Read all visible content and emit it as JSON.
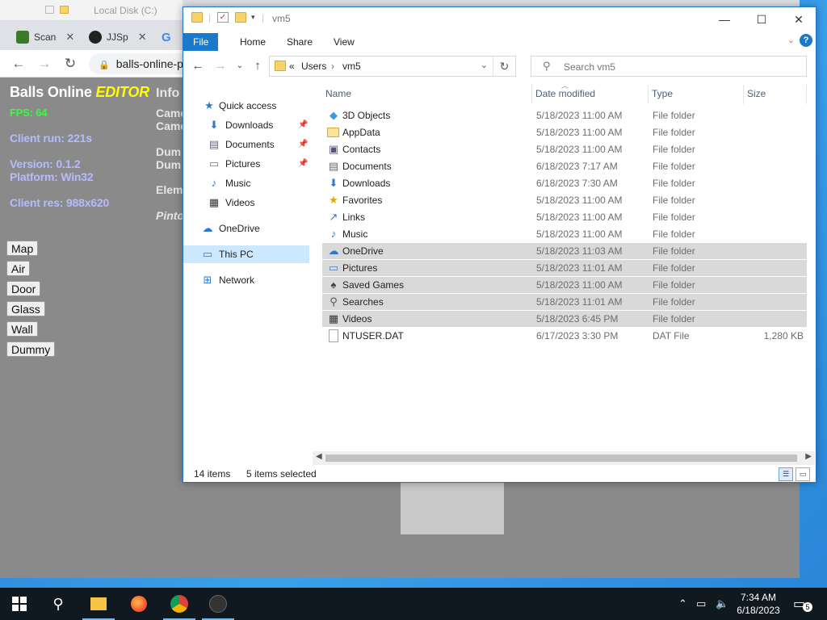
{
  "background_explorer": {
    "title": "Local Disk (C:)"
  },
  "browser": {
    "tabs": [
      {
        "label": "Scan",
        "color": "#3a7a2a"
      },
      {
        "label": "JJSp",
        "color": "#222222"
      },
      {
        "label": "",
        "color": "#ffffff"
      }
    ],
    "url": "balls-online-p"
  },
  "game": {
    "title": "Balls Online",
    "title_editor": "EDITOR",
    "fps": "FPS: 64",
    "client_run": "Client run: 221s",
    "version": "Version: 0.1.2",
    "platform": "Platform: Win32",
    "client_res": "Client res: 988x620",
    "info_header": "Info",
    "info_lines": [
      "Came",
      "Came",
      "Dum",
      "Dum",
      "Elem",
      "Pinto"
    ],
    "tools": [
      "Map",
      "Air",
      "Door",
      "Glass",
      "Wall",
      "Dummy"
    ]
  },
  "explorer": {
    "title": "vm5",
    "ribbon_tabs": [
      "File",
      "Home",
      "Share",
      "View"
    ],
    "help": "?",
    "address": {
      "prefix": "«",
      "crumbs": [
        "Users",
        "vm5"
      ]
    },
    "search_placeholder": "Search vm5",
    "nav": {
      "quick_access": "Quick access",
      "items": [
        "Downloads",
        "Documents",
        "Pictures",
        "Music",
        "Videos"
      ],
      "onedrive": "OneDrive",
      "this_pc": "This PC",
      "network": "Network"
    },
    "columns": {
      "name": "Name",
      "date": "Date modified",
      "type": "Type",
      "size": "Size"
    },
    "files": [
      {
        "name": "3D Objects",
        "date": "5/18/2023 11:00 AM",
        "type": "File folder",
        "size": "",
        "icon": "3d-objects-icon",
        "selected": false
      },
      {
        "name": "AppData",
        "date": "5/18/2023 11:00 AM",
        "type": "File folder",
        "size": "",
        "icon": "folder-icon",
        "selected": false
      },
      {
        "name": "Contacts",
        "date": "5/18/2023 11:00 AM",
        "type": "File folder",
        "size": "",
        "icon": "contacts-icon",
        "selected": false
      },
      {
        "name": "Documents",
        "date": "6/18/2023 7:17 AM",
        "type": "File folder",
        "size": "",
        "icon": "documents-icon",
        "selected": false
      },
      {
        "name": "Downloads",
        "date": "6/18/2023 7:30 AM",
        "type": "File folder",
        "size": "",
        "icon": "downloads-icon",
        "selected": false
      },
      {
        "name": "Favorites",
        "date": "5/18/2023 11:00 AM",
        "type": "File folder",
        "size": "",
        "icon": "favorites-icon",
        "selected": false
      },
      {
        "name": "Links",
        "date": "5/18/2023 11:00 AM",
        "type": "File folder",
        "size": "",
        "icon": "links-icon",
        "selected": false
      },
      {
        "name": "Music",
        "date": "5/18/2023 11:00 AM",
        "type": "File folder",
        "size": "",
        "icon": "music-icon",
        "selected": false
      },
      {
        "name": "OneDrive",
        "date": "5/18/2023 11:03 AM",
        "type": "File folder",
        "size": "",
        "icon": "onedrive-icon",
        "selected": true
      },
      {
        "name": "Pictures",
        "date": "5/18/2023 11:01 AM",
        "type": "File folder",
        "size": "",
        "icon": "pictures-icon",
        "selected": true
      },
      {
        "name": "Saved Games",
        "date": "5/18/2023 11:00 AM",
        "type": "File folder",
        "size": "",
        "icon": "saved-games-icon",
        "selected": true
      },
      {
        "name": "Searches",
        "date": "5/18/2023 11:01 AM",
        "type": "File folder",
        "size": "",
        "icon": "searches-icon",
        "selected": true
      },
      {
        "name": "Videos",
        "date": "5/18/2023 6:45 PM",
        "type": "File folder",
        "size": "",
        "icon": "videos-icon",
        "selected": true
      },
      {
        "name": "NTUSER.DAT",
        "date": "6/17/2023 3:30 PM",
        "type": "DAT File",
        "size": "1,280 KB",
        "icon": "file-icon",
        "selected": false
      }
    ],
    "status": {
      "items": "14 items",
      "selected": "5 items selected"
    }
  },
  "taskbar": {
    "clock_time": "7:34 AM",
    "clock_date": "6/18/2023",
    "notifications": "5"
  },
  "colors": {
    "accent": "#1979ca",
    "selection": "#d9d9d9",
    "taskbar": "#101820"
  }
}
